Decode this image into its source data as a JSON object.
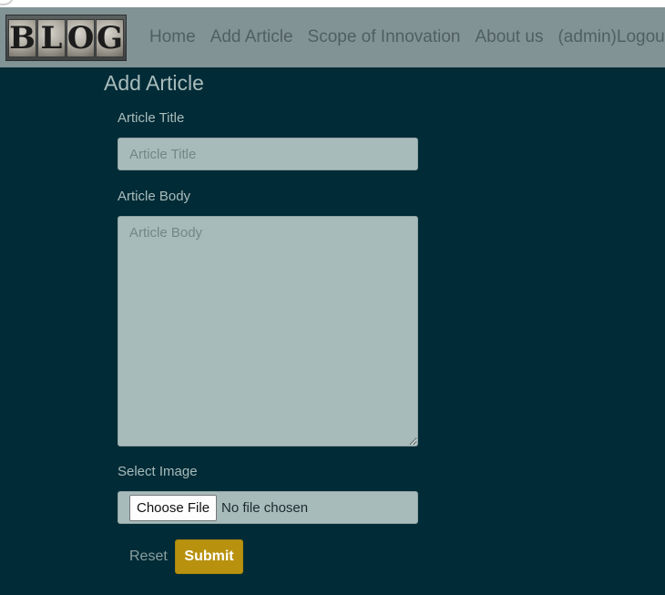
{
  "brand": {
    "logo_letters": [
      "B",
      "L",
      "O",
      "G"
    ]
  },
  "nav": {
    "items": [
      {
        "label": "Home"
      },
      {
        "label": "Add Article"
      },
      {
        "label": "Scope of Innovation"
      },
      {
        "label": "About us"
      },
      {
        "label": "(admin)Logout"
      }
    ]
  },
  "page": {
    "title": "Add Article"
  },
  "form": {
    "title_label": "Article Title",
    "title_placeholder": "Article Title",
    "title_value": "",
    "body_label": "Article Body",
    "body_placeholder": "Article Body",
    "body_value": "",
    "image_label": "Select Image",
    "choose_file_label": "Choose File",
    "file_status": "No file chosen",
    "reset_label": "Reset",
    "submit_label": "Submit"
  },
  "colors": {
    "background": "#012b36",
    "navbar": "#829396",
    "input_bg": "#a8bbbb",
    "submit": "#b8920f"
  }
}
